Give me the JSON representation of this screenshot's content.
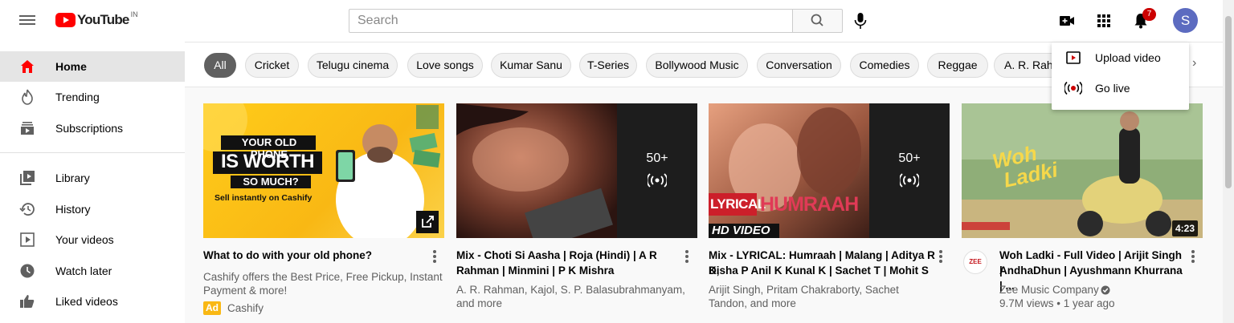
{
  "header": {
    "logo_text": "YouTube",
    "logo_region": "IN",
    "search_placeholder": "Search",
    "notification_count": "7",
    "avatar_letter": "S"
  },
  "sidebar": {
    "items": [
      {
        "label": "Home",
        "icon": "home-icon"
      },
      {
        "label": "Trending",
        "icon": "trending-icon"
      },
      {
        "label": "Subscriptions",
        "icon": "subscriptions-icon"
      },
      {
        "label": "Library",
        "icon": "library-icon"
      },
      {
        "label": "History",
        "icon": "history-icon"
      },
      {
        "label": "Your videos",
        "icon": "your-videos-icon"
      },
      {
        "label": "Watch later",
        "icon": "watch-later-icon"
      },
      {
        "label": "Liked videos",
        "icon": "liked-videos-icon"
      }
    ]
  },
  "chips": [
    "All",
    "Cricket",
    "Telugu cinema",
    "Love songs",
    "Kumar Sanu",
    "T-Series",
    "Bollywood Music",
    "Conversation",
    "Comedies",
    "Reggae",
    "A. R. Rahm"
  ],
  "create_menu": {
    "items": [
      {
        "label": "Upload video",
        "icon": "upload-video-icon"
      },
      {
        "label": "Go live",
        "icon": "go-live-icon"
      }
    ]
  },
  "videos": [
    {
      "thumb_line1": "YOUR OLD PHONE",
      "thumb_line2": "IS WORTH",
      "thumb_line3": "SO MUCH?",
      "thumb_line4": "Sell instantly on Cashify",
      "title": "What to do with your old phone?",
      "desc": "Cashify offers the Best Price, Free Pickup, Instant Payment & more!",
      "ad_badge": "Ad",
      "channel": "Cashify"
    },
    {
      "playlist_count": "50+",
      "title_line1": "Mix - Choti Si Aasha | Roja (Hindi) | A R",
      "title_line2": "Rahman | Minmini | P K Mishra",
      "meta_line1": "A. R. Rahman, Kajol, S. P. Balasubrahmanyam,",
      "meta_line2": "and more"
    },
    {
      "playlist_count": "50+",
      "overlay_label": "LYRICAL",
      "overlay_song": "HUMRAAH",
      "overlay_hd": "HD VIDEO",
      "title_line1": "Mix - LYRICAL: Humraah | Malang | Aditya R K,",
      "title_line2": "Disha P Anil K Kunal K | Sachet T | Mohit S",
      "meta_line1": "Arijit Singh, Pritam Chakraborty, Sachet",
      "meta_line2": "Tandon, and more"
    },
    {
      "thumb_title1": "Woh",
      "thumb_title2": "Ladki",
      "duration": "4:23",
      "title_line1": "Woh Ladki - Full Video | Arijit Singh |",
      "title_line2": "AndhaDhun | Ayushmann Khurrana | ...",
      "channel": "Zee Music Company",
      "stats": "9.7M views • 1 year ago",
      "channel_avatar_text": "ZEE"
    }
  ],
  "colors": {
    "brand_red": "#ff0000",
    "active_chip": "#606060",
    "badge_red": "#cc0000",
    "avatar": "#5c6bc0",
    "ad_yellow": "#f9b814"
  }
}
